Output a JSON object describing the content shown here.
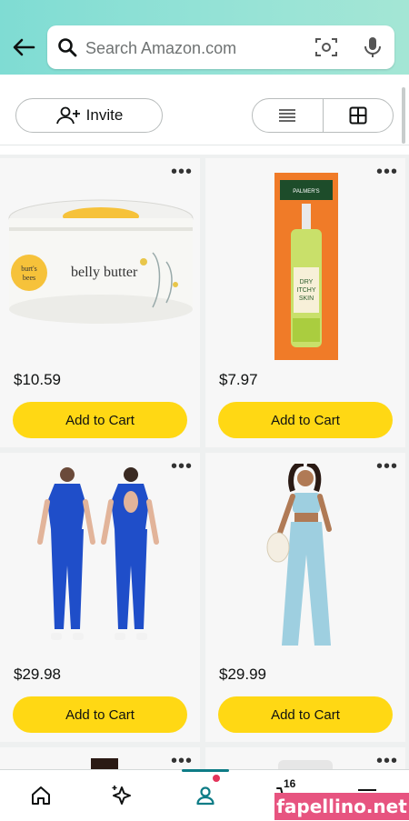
{
  "search": {
    "placeholder": "Search Amazon.com"
  },
  "toolbar": {
    "invite_label": "Invite"
  },
  "products": [
    {
      "price": "$10.59",
      "button": "Add to Cart",
      "brand": "burt's bees MAMA",
      "name": "belly butter"
    },
    {
      "price": "$7.97",
      "button": "Add to Cart",
      "brand": "PALMER'S COCOA BUTTER FORMULA",
      "name": "DRY ITCHY SKIN"
    },
    {
      "price": "$29.98",
      "button": "Add to Cart"
    },
    {
      "price": "$29.99",
      "button": "Add to Cart"
    }
  ],
  "cart": {
    "count": "16"
  },
  "watermark": "fapellino.net",
  "colors": {
    "accent": "#ffd814",
    "teal": "#0e7c86",
    "header": "#93e2d6"
  }
}
